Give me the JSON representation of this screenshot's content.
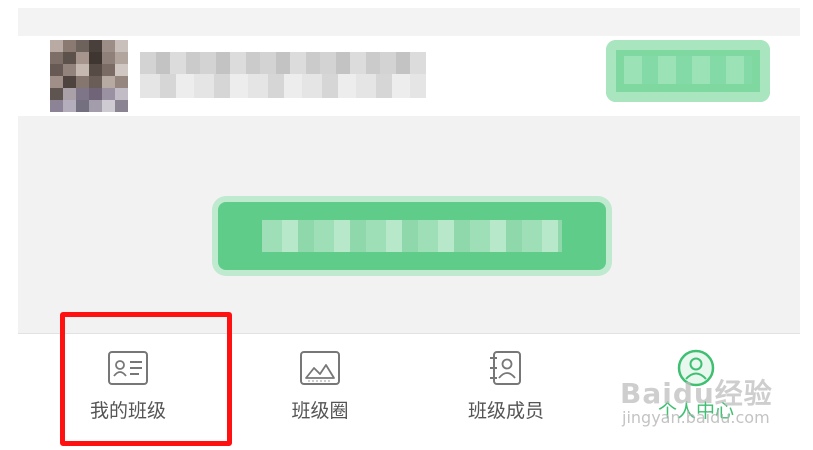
{
  "tabbar": {
    "tabs": [
      {
        "label": "我的班级",
        "icon": "id-card-icon"
      },
      {
        "label": "班级圈",
        "icon": "photo-icon"
      },
      {
        "label": "班级成员",
        "icon": "contact-list-icon"
      },
      {
        "label": "个人中心",
        "icon": "person-circle-icon"
      }
    ],
    "active_index": 3
  },
  "watermark": {
    "brand": "Baidu经验",
    "url": "jingyan.baidu.com"
  },
  "colors": {
    "accent_green": "#3fbf72",
    "highlight_red": "#ff1111",
    "panel_gray": "#f2f2f2"
  }
}
